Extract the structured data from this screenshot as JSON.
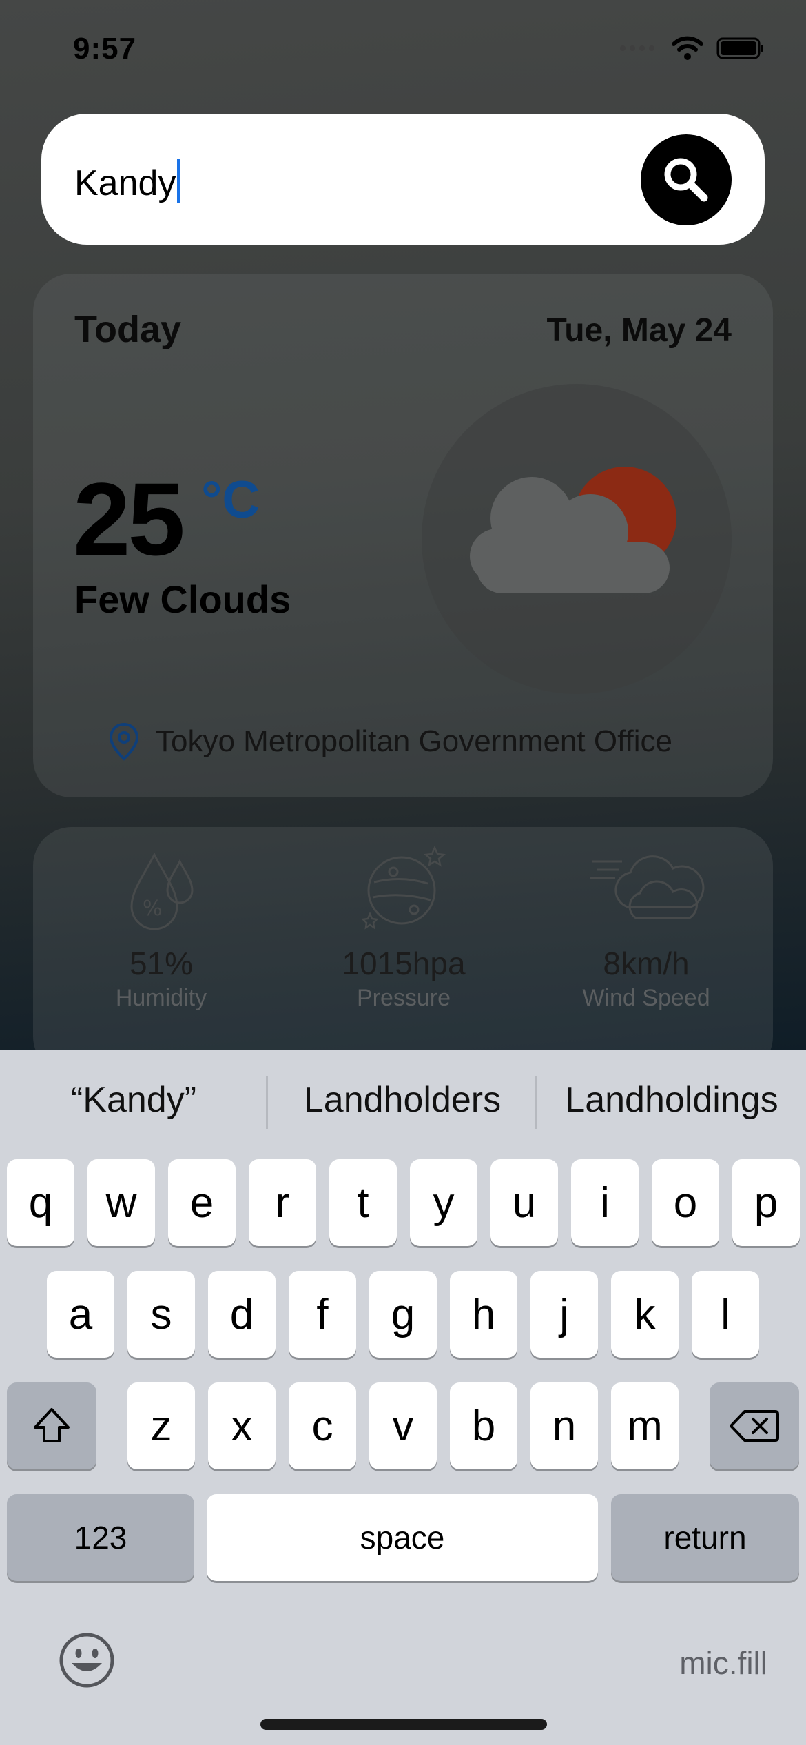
{
  "status_bar": {
    "time": "9:57"
  },
  "search": {
    "value": "Kandy"
  },
  "today_card": {
    "label": "Today",
    "date": "Tue, May 24",
    "temperature": "25",
    "unit": "°C",
    "condition": "Few Clouds",
    "location": "Tokyo Metropolitan Government Office"
  },
  "stats": [
    {
      "value": "51%",
      "label": "Humidity",
      "icon": "humidity-icon"
    },
    {
      "value": "1015hpa",
      "label": "Pressure",
      "icon": "pressure-icon"
    },
    {
      "value": "8km/h",
      "label": "Wind Speed",
      "icon": "wind-icon"
    }
  ],
  "keyboard": {
    "suggestions": [
      "“Kandy”",
      "Landholders",
      "Landholdings"
    ],
    "row1": [
      "q",
      "w",
      "e",
      "r",
      "t",
      "y",
      "u",
      "i",
      "o",
      "p"
    ],
    "row2": [
      "a",
      "s",
      "d",
      "f",
      "g",
      "h",
      "j",
      "k",
      "l"
    ],
    "row3": [
      "z",
      "x",
      "c",
      "v",
      "b",
      "n",
      "m"
    ],
    "numbers_key": "123",
    "space_key": "space",
    "return_key": "return",
    "mic_label": "mic.fill"
  },
  "colors": {
    "accent": "#0f4b8f",
    "caret": "#1a73e8",
    "sun": "#c0391b"
  }
}
